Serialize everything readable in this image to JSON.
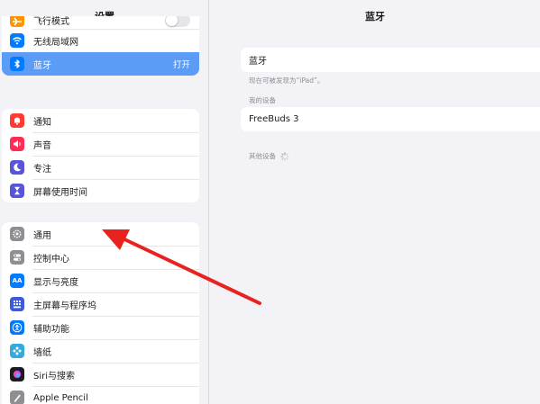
{
  "sidebar": {
    "title": "设置",
    "connectivity": [
      {
        "label": "飞行模式",
        "icon": "airplane-icon",
        "color": "#ff9500",
        "toggle": false
      },
      {
        "label": "无线局域网",
        "icon": "wifi-icon",
        "color": "#007aff"
      },
      {
        "label": "蓝牙",
        "icon": "bluetooth-icon",
        "color": "#007aff",
        "value": "打开",
        "selected": true
      }
    ],
    "focus": [
      {
        "label": "通知",
        "icon": "bell-icon",
        "color": "#ff3b30"
      },
      {
        "label": "声音",
        "icon": "speaker-icon",
        "color": "#ff2d55"
      },
      {
        "label": "专注",
        "icon": "moon-icon",
        "color": "#5856d6"
      },
      {
        "label": "屏幕使用时间",
        "icon": "hourglass-icon",
        "color": "#5856d6"
      }
    ],
    "general": [
      {
        "label": "通用",
        "icon": "gear-icon",
        "color": "#8e8e93"
      },
      {
        "label": "控制中心",
        "icon": "switches-icon",
        "color": "#8e8e93"
      },
      {
        "label": "显示与亮度",
        "icon": "text-size-icon",
        "color": "#007aff"
      },
      {
        "label": "主屏幕与程序坞",
        "icon": "grid-icon",
        "color": "#3a5be0"
      },
      {
        "label": "辅助功能",
        "icon": "accessibility-icon",
        "color": "#007aff"
      },
      {
        "label": "墙纸",
        "icon": "flower-icon",
        "color": "#34aadc"
      },
      {
        "label": "Siri与搜索",
        "icon": "siri-icon",
        "color": "#1c1c1e"
      },
      {
        "label": "Apple Pencil",
        "icon": "pencil-icon",
        "color": "#8e8e93"
      }
    ]
  },
  "detail": {
    "title": "蓝牙",
    "bluetooth_label": "蓝牙",
    "discoverable_text": "现在可被发现为“iPad”。",
    "my_devices_header": "我的设备",
    "device_name": "FreeBuds 3",
    "other_devices_header": "其他设备"
  },
  "annotation": {
    "arrow_color": "#e8231f"
  }
}
